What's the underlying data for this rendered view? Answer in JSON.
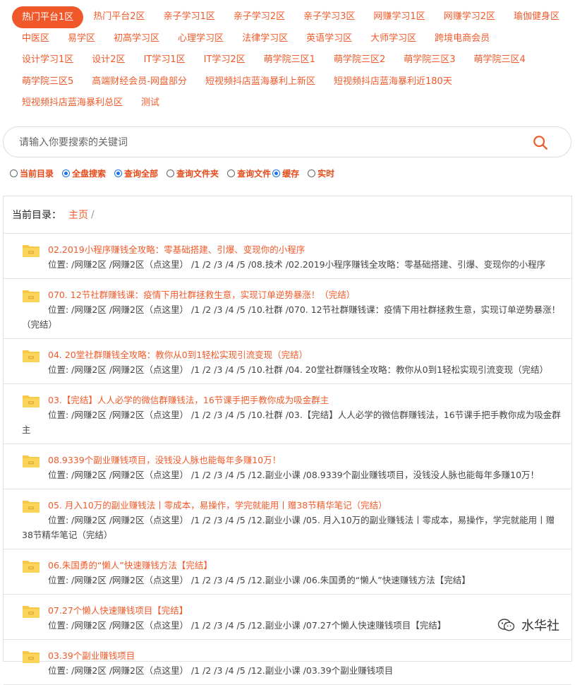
{
  "tabs": [
    [
      "热门平台1区",
      "热门平台2区",
      "亲子学习1区",
      "亲子学习2区",
      "亲子学习3区",
      "网赚学习1区",
      "网赚学习2区",
      "瑜伽健身区"
    ],
    [
      "中医区",
      "易学区",
      "初高学习区",
      "心理学习区",
      "法律学习区",
      "英语学习区",
      "大师学习区",
      "跨境电商会员"
    ],
    [
      "设计学习1区",
      "设计2区",
      "IT学习1区",
      "IT学习2区",
      "萌学院三区1",
      "萌学院三区2",
      "萌学院三区3",
      "萌学院三区4"
    ],
    [
      "萌学院三区5",
      "高端财经会员-网盘部分",
      "短视频抖店蓝海暴利上新区",
      "短视频抖店蓝海暴利近180天"
    ],
    [
      "短视频抖店蓝海暴利总区",
      "测试"
    ]
  ],
  "search": {
    "placeholder": "请输入你要搜索的关键词",
    "icon": "search-icon"
  },
  "options": [
    {
      "label": "当前目录",
      "checked": false
    },
    {
      "label": "全盘搜索",
      "checked": true
    },
    {
      "label": "查询全部",
      "checked": true
    },
    {
      "label": "查询文件夹",
      "checked": false
    },
    {
      "label": "查询文件",
      "checked": false
    },
    {
      "label": "缓存",
      "checked": true
    },
    {
      "label": "实时",
      "checked": false
    }
  ],
  "breadcrumb": {
    "label": "当前目录：",
    "home": "主页",
    "sep": "/"
  },
  "items": [
    {
      "title": "02.2019小程序赚钱全攻略：零基础搭建、引爆、变现你的小程序",
      "path": "位置: /网赚2区 /网赚2区（点这里） /1 /2 /3 /4 /5 /08.技术 /02.2019小程序赚钱全攻略：零基础搭建、引爆、变现你的小程序"
    },
    {
      "title": "070. 12节社群赚钱课：疫情下用社群拯救生意，实现订单逆势暴涨！（完结）",
      "path": "位置: /网赚2区 /网赚2区（点这里） /1 /2 /3 /4 /5 /10.社群 /070. 12节社群赚钱课：疫情下用社群拯救生意，实现订单逆势暴涨！（完结）"
    },
    {
      "title": "04. 20堂社群赚钱全攻略：教你从0到1轻松实现引流变现（完结）",
      "path": "位置: /网赚2区 /网赚2区（点这里） /1 /2 /3 /4 /5 /10.社群 /04. 20堂社群赚钱全攻略：教你从0到1轻松实现引流变现（完结）"
    },
    {
      "title": "03.【完结】人人必学的微信群赚钱法，16节课手把手教你成为吸金群主",
      "path": "位置: /网赚2区 /网赚2区（点这里） /1 /2 /3 /4 /5 /10.社群 /03.【完结】人人必学的微信群赚钱法，16节课手把手教你成为吸金群主"
    },
    {
      "title": "08.9339个副业赚钱项目，没钱没人脉也能每年多赚10万！",
      "path": "位置: /网赚2区 /网赚2区（点这里） /1 /2 /3 /4 /5 /12.副业小课 /08.9339个副业赚钱项目，没钱没人脉也能每年多赚10万！"
    },
    {
      "title": "05. 月入10万的副业赚钱法丨零成本，易操作，学完就能用丨赠38节精华笔记（完结）",
      "path": "位置: /网赚2区 /网赚2区（点这里） /1 /2 /3 /4 /5 /12.副业小课 /05. 月入10万的副业赚钱法丨零成本，易操作，学完就能用丨赠38节精华笔记（完结）"
    },
    {
      "title": "06.朱国勇的“懒人”快速赚钱方法【完结】",
      "path": "位置: /网赚2区 /网赚2区（点这里） /1 /2 /3 /4 /5 /12.副业小课 /06.朱国勇的“懒人”快速赚钱方法【完结】"
    },
    {
      "title": "07.27个懒人快速赚钱项目【完结】",
      "path": "位置: /网赚2区 /网赚2区（点这里） /1 /2 /3 /4 /5 /12.副业小课 /07.27个懒人快速赚钱项目【完结】"
    },
    {
      "title": "03.39个副业赚钱项目",
      "path": "位置: /网赚2区 /网赚2区（点这里） /1 /2 /3 /4 /5 /12.副业小课 /03.39个副业赚钱项目"
    }
  ],
  "watermark": "水华社",
  "colors": {
    "accent": "#f05a2a",
    "radio": "#1a73e8",
    "folder": "#f7c846"
  }
}
